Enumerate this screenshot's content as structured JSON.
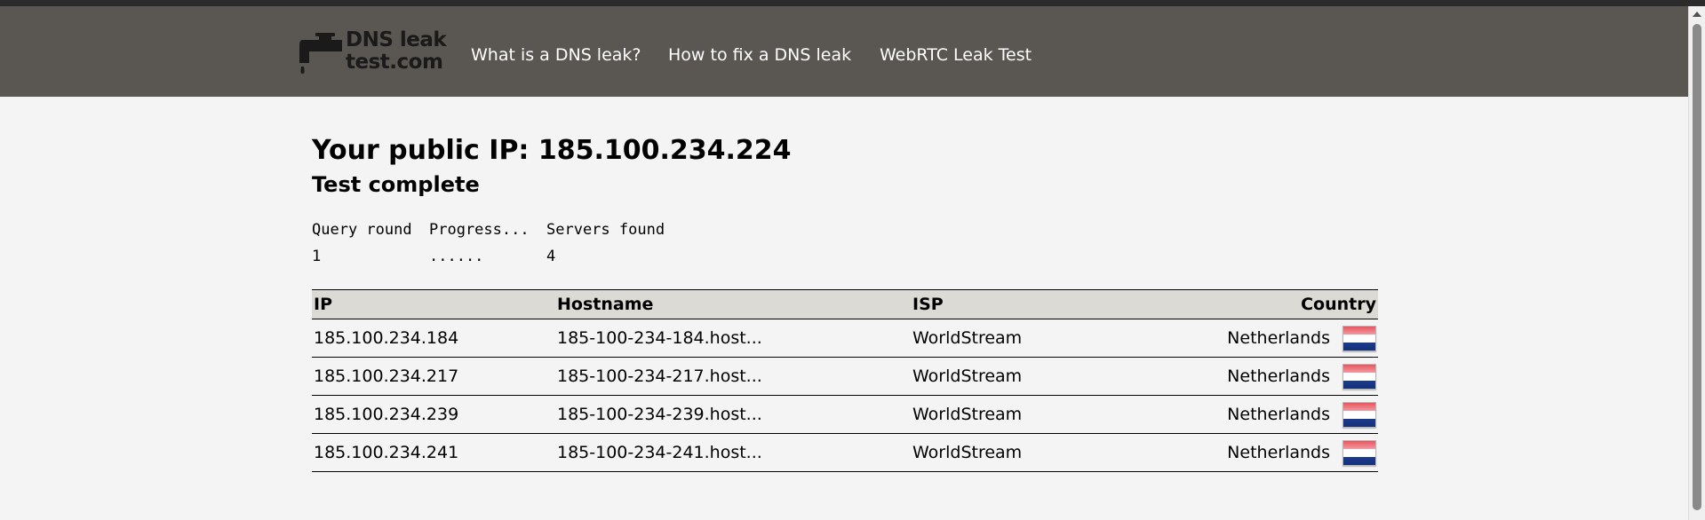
{
  "header": {
    "logo_line1": "DNS leak",
    "logo_line2": "test.com",
    "nav": [
      {
        "label": "What is a DNS leak?"
      },
      {
        "label": "How to fix a DNS leak"
      },
      {
        "label": "WebRTC Leak Test"
      }
    ]
  },
  "main": {
    "ip_title": "Your public IP: 185.100.234.224",
    "status": "Test complete",
    "progress": {
      "headers": [
        "Query round",
        "Progress...",
        "Servers found"
      ],
      "row": [
        "1",
        "......",
        "4"
      ]
    },
    "table": {
      "headers": [
        "IP",
        "Hostname",
        "ISP",
        "Country"
      ],
      "rows": [
        {
          "ip": "185.100.234.184",
          "hostname": "185-100-234-184.host...",
          "isp": "WorldStream",
          "country": "Netherlands",
          "flag": "netherlands-flag"
        },
        {
          "ip": "185.100.234.217",
          "hostname": "185-100-234-217.host...",
          "isp": "WorldStream",
          "country": "Netherlands",
          "flag": "netherlands-flag"
        },
        {
          "ip": "185.100.234.239",
          "hostname": "185-100-234-239.host...",
          "isp": "WorldStream",
          "country": "Netherlands",
          "flag": "netherlands-flag"
        },
        {
          "ip": "185.100.234.241",
          "hostname": "185-100-234-241.host...",
          "isp": "WorldStream",
          "country": "Netherlands",
          "flag": "netherlands-flag"
        }
      ]
    }
  },
  "colors": {
    "navbar": "#5a5651",
    "page_background": "#f4f4f4",
    "table_header": "#dcdad5"
  }
}
